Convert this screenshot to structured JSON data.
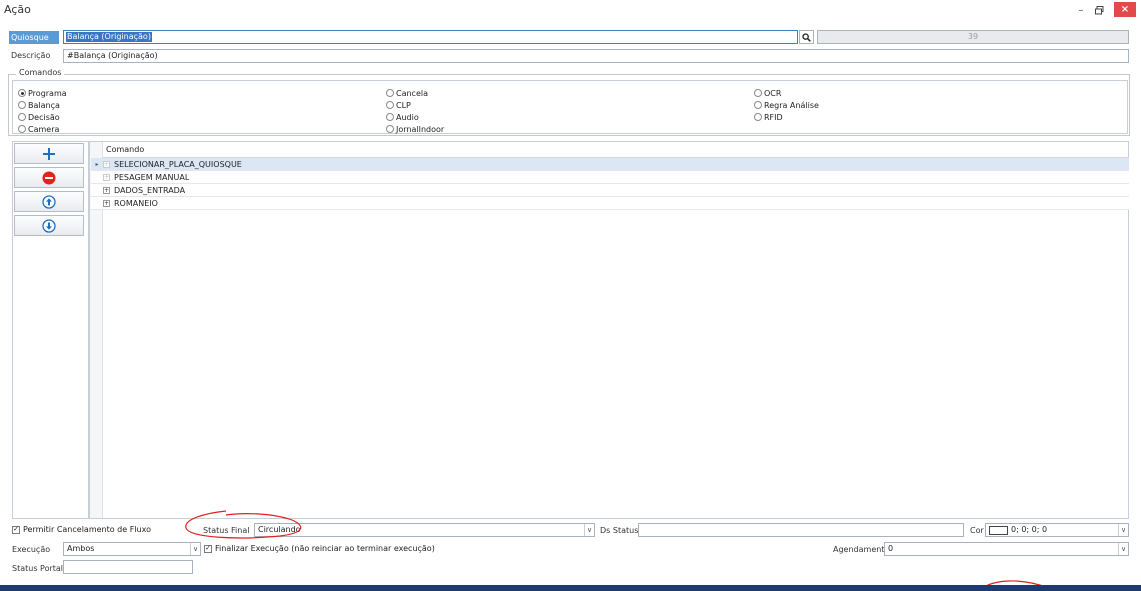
{
  "window": {
    "title": "Ação",
    "minimize_label": "–",
    "restore_label": "🗗",
    "close_label": "×",
    "close_color": "#d9534f"
  },
  "form": {
    "quiosque_label": "Quiosque",
    "quiosque_value": "Balança (Originação)",
    "quiosque_id": "39",
    "descricao_label": "Descrição",
    "descricao_value": "#Balança (Originação)"
  },
  "comandos": {
    "group_label": "Comandos",
    "options": [
      {
        "label": "Programa",
        "selected": true
      },
      {
        "label": "Balança",
        "selected": false
      },
      {
        "label": "Decisão",
        "selected": false
      },
      {
        "label": "Camera",
        "selected": false
      },
      {
        "label": "Cancela",
        "selected": false
      },
      {
        "label": "CLP",
        "selected": false
      },
      {
        "label": "Audio",
        "selected": false
      },
      {
        "label": "JornalIndoor",
        "selected": false
      },
      {
        "label": "OCR",
        "selected": false
      },
      {
        "label": "Regra Análise",
        "selected": false
      },
      {
        "label": "RFID",
        "selected": false
      }
    ]
  },
  "toolbar": {
    "add_icon": "plus-icon",
    "remove_icon": "minus-circle-icon",
    "up_icon": "arrow-up-circle-icon",
    "down_icon": "arrow-down-circle-icon",
    "accent": "#1f6fbf",
    "remove_color": "#e0241b"
  },
  "grid": {
    "column_header": "Comando",
    "rows": [
      {
        "label": "SELECIONAR_PLACA_QUIOSQUE",
        "expander": "+",
        "current": true
      },
      {
        "label": "PESAGEM MANUAL",
        "expander": "+",
        "current": false
      },
      {
        "label": "DADOS_ENTRADA",
        "expander": "+",
        "current": false
      },
      {
        "label": "ROMANEIO",
        "expander": "+",
        "current": false
      }
    ]
  },
  "footer": {
    "permitir_cancelamento": "Permitir Cancelamento de Fluxo",
    "status_final_label": "Status Final",
    "status_final_value": "Circulando",
    "ds_status_label": "Ds Status",
    "ds_status_value": "",
    "cor_label": "Cor",
    "cor_value": "0; 0; 0; 0",
    "execucao_label": "Execução",
    "execucao_value": "Ambos",
    "finalizar_label": "Finalizar Execução (não reinciar ao terminar execução)",
    "agendamento_label": "Agendamento",
    "agendamento_value": "0",
    "status_portal_label": "Status Portal",
    "status_portal_value": ""
  }
}
